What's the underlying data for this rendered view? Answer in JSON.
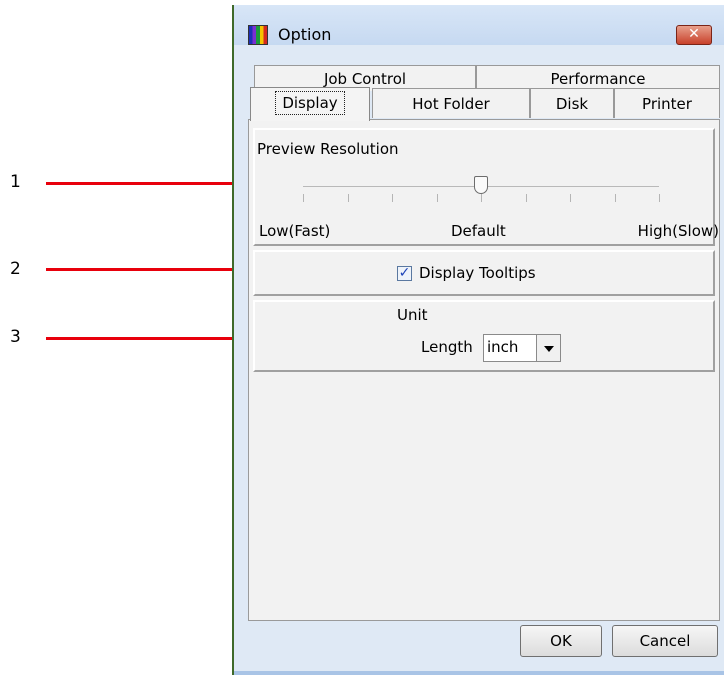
{
  "callouts": [
    "1",
    "2",
    "3"
  ],
  "window": {
    "title": "Option",
    "close_glyph": "✕"
  },
  "tabs": {
    "row1": [
      "Job Control",
      "Performance"
    ],
    "row2": [
      "Display",
      "Hot Folder",
      "Disk",
      "Printer"
    ],
    "active": "Display"
  },
  "preview": {
    "label": "Preview Resolution",
    "low_label": "Low(Fast)",
    "default_label": "Default",
    "high_label": "High(Slow)",
    "tick_count": 9,
    "selected_tick_index": 4
  },
  "tooltips": {
    "label": "Display Tooltips",
    "checked": true,
    "check_glyph": "✓"
  },
  "unit": {
    "heading": "Unit",
    "length_label": "Length",
    "length_value": "inch"
  },
  "buttons": {
    "ok": "OK",
    "cancel": "Cancel"
  },
  "colors": {
    "callout_line": "#e8000c",
    "checkmark": "#1e44b8"
  },
  "icons": {
    "app": "app-color-bars-icon",
    "close": "close-x-icon",
    "dropdown": "chevron-down-icon"
  }
}
